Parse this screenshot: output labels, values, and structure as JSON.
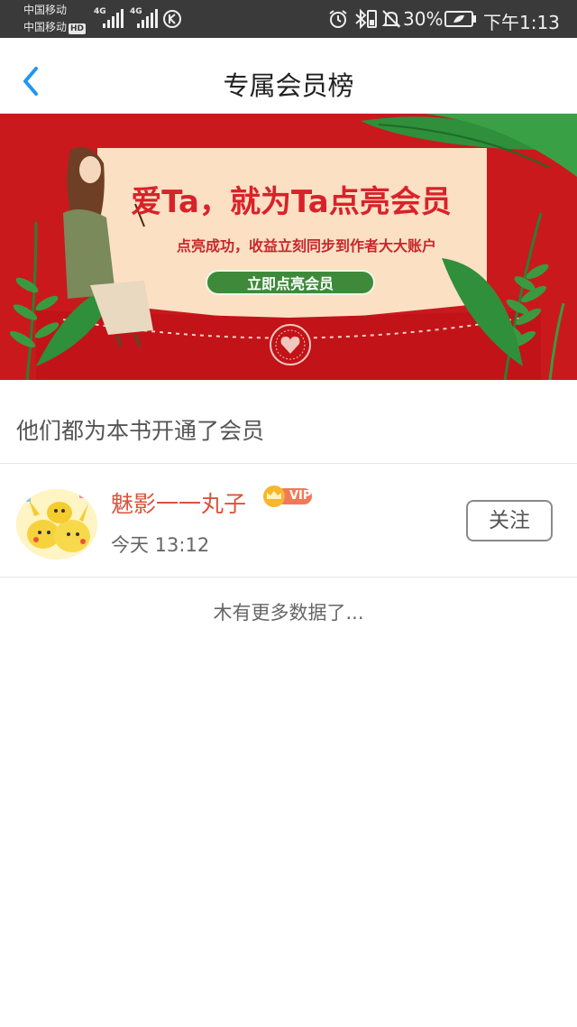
{
  "status_bar": {
    "carrier_1": "中国移动",
    "carrier_2": "中国移动",
    "hd": "HD",
    "network_1": "4G",
    "network_2": "4G",
    "battery_percent": "30%",
    "time": "下午1:13",
    "icons": [
      "signal-icon",
      "k-app-icon",
      "alarm-icon",
      "bluetooth-icon",
      "vibrate-icon",
      "mute-bell-icon",
      "battery-icon"
    ]
  },
  "header": {
    "title": "专属会员榜",
    "back_icon": "back-chevron-icon"
  },
  "banner": {
    "headline": "爱Ta，就为Ta点亮会员",
    "subtitle": "点亮成功，收益立刻同步到作者大大账户",
    "cta_label": "立即点亮会员",
    "colors": {
      "red": "#c9191d",
      "paper": "#fbe0c4",
      "green": "#3e8a3a"
    }
  },
  "section": {
    "title": "他们都为本书开通了会员"
  },
  "members": [
    {
      "name": "魅影一一丸子",
      "badge": "VIP",
      "time": "今天 13:12",
      "follow_label": "关注"
    }
  ],
  "footer": {
    "no_more_text": "木有更多数据了..."
  },
  "colors": {
    "accent_blue": "#2196f3",
    "name_red": "#d9533b",
    "vip_orange": "#f07a57"
  }
}
